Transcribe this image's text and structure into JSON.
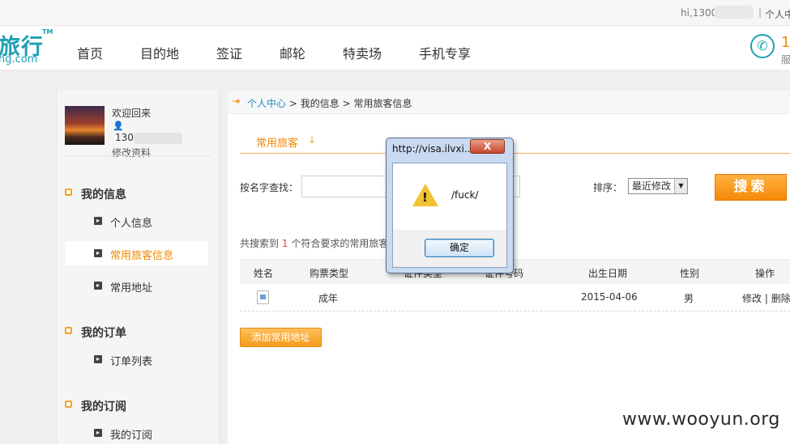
{
  "topbar": {
    "greeting": "hi,1300",
    "separator": "|",
    "user_center": "个人中"
  },
  "header": {
    "logo_cn": "旅行",
    "logo_tm": "TM",
    "logo_en": "ng.com",
    "nav": [
      "首页",
      "目的地",
      "签证",
      "邮轮",
      "特卖场",
      "手机专享"
    ],
    "phone_number": "1",
    "phone_sub": "服"
  },
  "sidebar": {
    "welcome": "欢迎回来",
    "phone_masked": "130",
    "edit_profile": "修改资料",
    "sections": [
      {
        "title": "我的信息",
        "items": [
          "个人信息",
          "常用旅客信息",
          "常用地址"
        ]
      },
      {
        "title": "我的订单",
        "items": [
          "订单列表"
        ]
      },
      {
        "title": "我的订阅",
        "items": [
          "我的订阅"
        ]
      }
    ],
    "active_item": "常用旅客信息"
  },
  "main": {
    "breadcrumb": {
      "home": "个人中心",
      "sep": ">",
      "level2": "我的信息",
      "level3": "常用旅客信息"
    },
    "tab_label": "常用旅客",
    "search_label": "按名字查找：",
    "search_value": "",
    "sort_label": "排序：",
    "sort_value": "最近修改",
    "search_button": "搜索",
    "result_prefix": "共搜索到",
    "result_count": "1",
    "result_suffix": "个符合要求的常用旅客",
    "table": {
      "headers": [
        "姓名",
        "购票类型",
        "证件类型",
        "证件号码",
        "出生日期",
        "性别",
        "操作"
      ],
      "rows": [
        {
          "name": "",
          "ticket_type": "成年",
          "id_type": "",
          "id_number": "",
          "birth": "2015-04-06",
          "gender": "男",
          "edit": "修改",
          "sep": "|",
          "delete": "删除"
        }
      ]
    },
    "add_button": "添加常用地址"
  },
  "dialog": {
    "title": "http://visa.ilvxi...",
    "close": "X",
    "message": "/fuck/",
    "ok": "确定"
  },
  "watermark": "www.wooyun.org",
  "colors": {
    "accent": "#f08a00",
    "brand": "#1d9fb4",
    "link": "#1a8fc9"
  }
}
